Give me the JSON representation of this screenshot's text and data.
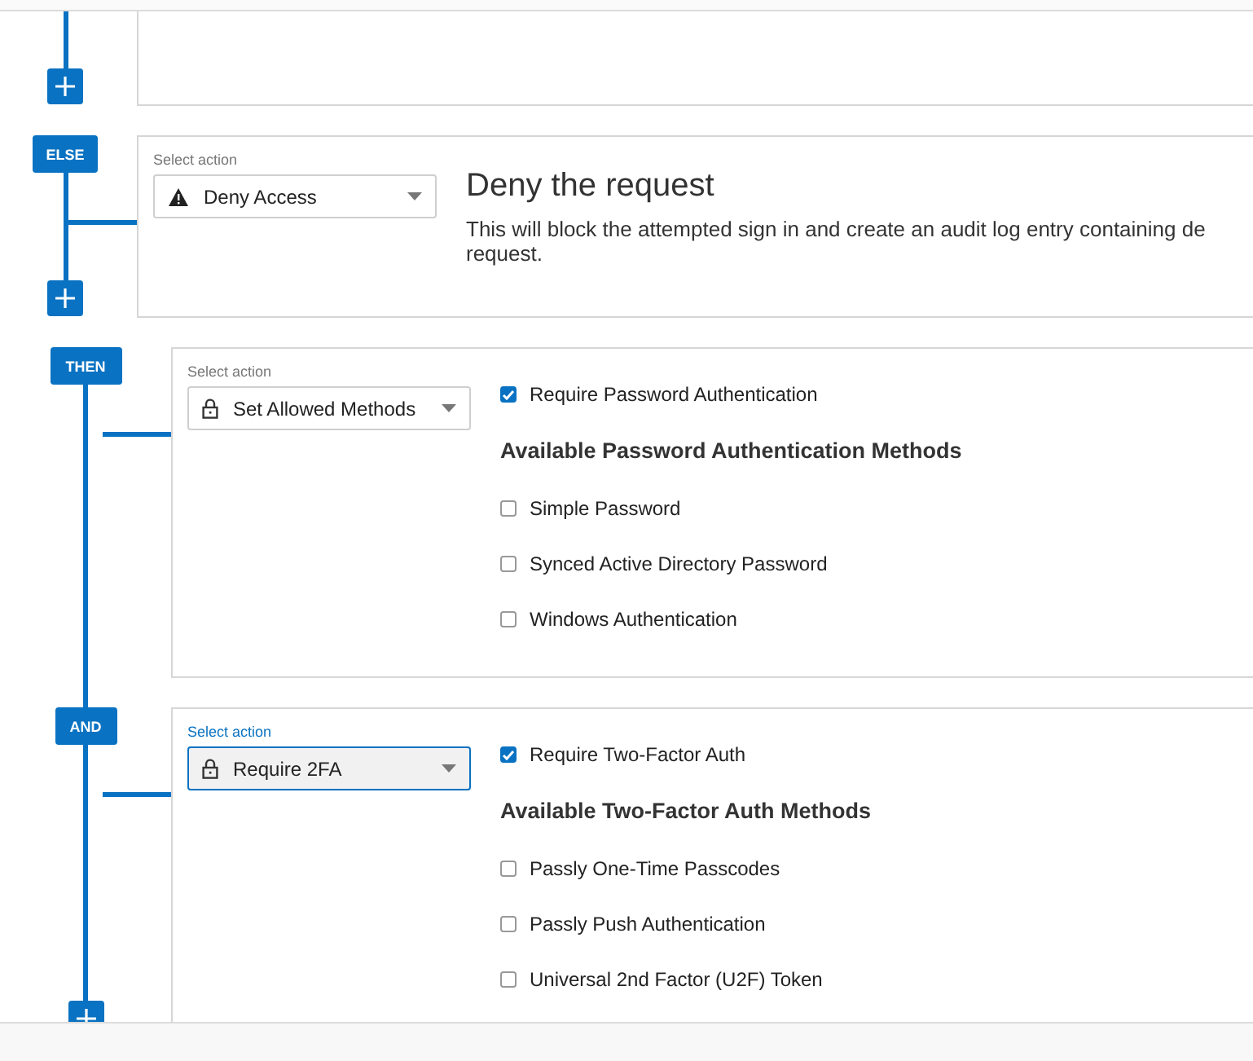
{
  "blocks": [
    {
      "kind": "empty",
      "nested": false,
      "add_button": true
    },
    {
      "kind": "deny",
      "nested": false,
      "badge": "ELSE",
      "add_button": true,
      "select": {
        "label": "Select action",
        "value": "Deny Access",
        "focused": false
      },
      "title": "Deny the request",
      "description_lines": [
        "This will block the attempted sign in and create an audit log entry containing de",
        "request."
      ]
    },
    {
      "kind": "methods",
      "nested": true,
      "badge": "THEN",
      "add_button": false,
      "select": {
        "label": "Select action",
        "value": "Set Allowed Methods",
        "focused": false
      },
      "require": {
        "label": "Require Password Authentication",
        "checked": true
      },
      "heading": "Available Password Authentication Methods",
      "options": [
        {
          "label": "Simple Password",
          "checked": false
        },
        {
          "label": "Synced Active Directory Password",
          "checked": false
        },
        {
          "label": "Windows Authentication",
          "checked": false
        }
      ]
    },
    {
      "kind": "methods",
      "nested": true,
      "badge": "AND",
      "add_button": true,
      "select": {
        "label": "Select action",
        "value": "Require 2FA",
        "focused": true
      },
      "require": {
        "label": "Require Two-Factor Auth",
        "checked": true
      },
      "heading": "Available Two-Factor Auth Methods",
      "options": [
        {
          "label": "Passly One-Time Passcodes",
          "checked": false
        },
        {
          "label": "Passly Push Authentication",
          "checked": false
        },
        {
          "label": "Universal 2nd Factor (U2F) Token",
          "checked": false
        }
      ]
    }
  ]
}
